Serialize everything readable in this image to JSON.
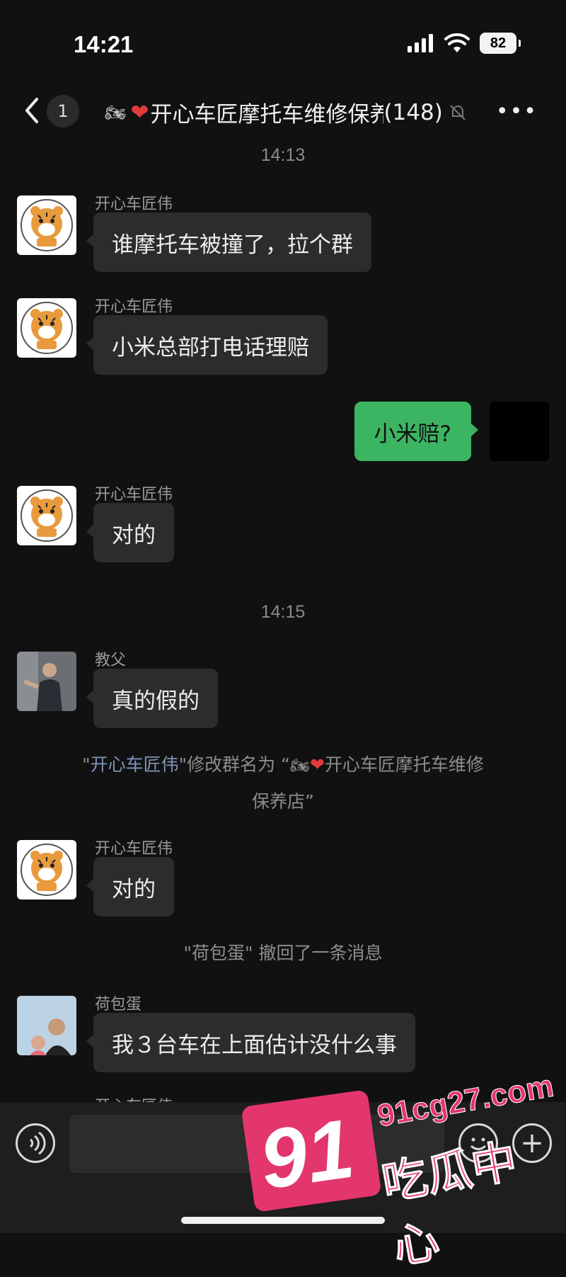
{
  "status_bar": {
    "time": "14:21",
    "battery": "82"
  },
  "nav": {
    "unread_count": "1",
    "title": "开心车匠摩托车维修保养店",
    "member_count": "(148)"
  },
  "timestamps": [
    "14:13",
    "14:15"
  ],
  "messages": [
    {
      "sender": "开心车匠伟",
      "text": "谁摩托车被撞了，拉个群"
    },
    {
      "sender": "开心车匠伟",
      "text": "小米总部打电话理赔"
    },
    {
      "sender": "me",
      "text": "小米赔?"
    },
    {
      "sender": "开心车匠伟",
      "text": "对的"
    },
    {
      "sender": "教父",
      "text": "真的假的"
    },
    {
      "sender": "开心车匠伟",
      "text": "对的"
    },
    {
      "sender": "荷包蛋",
      "text": "我３台车在上面估计没什么事"
    },
    {
      "sender": "开心车匠伟",
      "text": ""
    }
  ],
  "system": {
    "rename": {
      "actor": "开心车匠伟",
      "part1": "\"",
      "part2": "\"修改群名为 “",
      "newname": "开心车匠摩托车维修",
      "part3": "保养店”"
    },
    "recall": "\"荷包蛋\" 撤回了一条消息"
  },
  "watermark": {
    "number": "91",
    "url": "91cg27.com",
    "label": "吃瓜中心"
  },
  "colors": {
    "background": "#111111",
    "bubble_other": "#2c2c2c",
    "bubble_mine": "#3cb563",
    "heart": "#e23b3b",
    "link": "#7f93b9"
  }
}
